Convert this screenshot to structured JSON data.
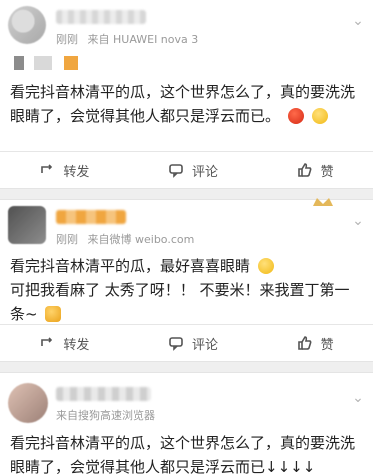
{
  "post1": {
    "meta": [
      "刚刚",
      "来自 HUAWEI nova 3"
    ],
    "text_line1": "看完抖音林清平的瓜，这个世界怎么了，真的要洗洗",
    "text_line2": "眼睛了，会觉得其他人都只是浮云而已。",
    "emojis": [
      "angry-emoji",
      "smile-emoji"
    ],
    "actions": {
      "repost": "转发",
      "comment": "评论",
      "like": "赞"
    }
  },
  "post2": {
    "meta": [
      "刚刚",
      "来自微博 weibo.com"
    ],
    "text_line1": "看完抖音林清平的瓜，最好喜喜眼睛",
    "text_line2": "可把我看麻了 太秀了呀！！ 不要米！来我置丁第一",
    "text_line3": "条~",
    "actions": {
      "repost": "转发",
      "comment": "评论",
      "like": "赞"
    }
  },
  "post3": {
    "meta": [
      "来自搜狗高速浏览器"
    ],
    "text_line1": "看完抖音林清平的瓜，这个世界怎么了，真的要洗洗",
    "text_line2": "眼睛了，会觉得其他人都只是浮云而已↓↓↓↓"
  },
  "colors": {
    "accent_orange": "#f0a640",
    "meta_gray": "#9a9a9a"
  }
}
